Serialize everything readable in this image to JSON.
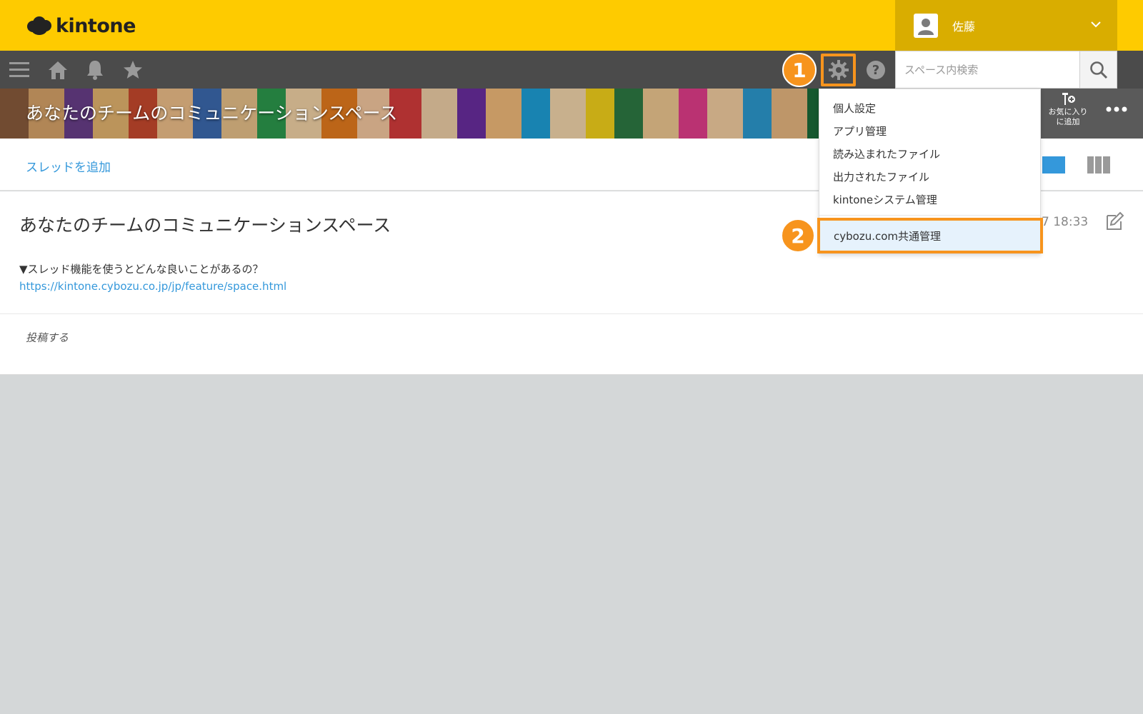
{
  "header": {
    "logo_text": "kintone",
    "user_name": "佐藤"
  },
  "toolbar": {
    "icons": [
      "menu-icon",
      "home-icon",
      "bell-icon",
      "star-icon",
      "gear-icon",
      "help-icon"
    ],
    "search_placeholder": "スペース内検索"
  },
  "steps": {
    "step1": "1",
    "step2": "2"
  },
  "banner": {
    "title": "あなたのチームのコミュニケーションスペース",
    "favorite_label_line1": "お気に入り",
    "favorite_label_line2": "に追加"
  },
  "thread_bar": {
    "add_thread": "スレッドを追加"
  },
  "thread": {
    "title": "あなたのチームのコミュニケーションスペース",
    "date": "7 18:33",
    "body": "▼スレッド機能を使うとどんな良いことがあるの？",
    "link": "https://kintone.cybozu.co.jp/jp/feature/space.html"
  },
  "post": {
    "label": "投稿する"
  },
  "dropdown": {
    "items": [
      "個人設定",
      "アプリ管理",
      "読み込まれたファイル",
      "出力されたファイル",
      "kintoneシステム管理"
    ],
    "highlighted": "cybozu.com共通管理"
  },
  "colors": {
    "header_yellow": "#fecb00",
    "toolbar_gray": "#4b4b4b",
    "accent_orange": "#f7941d",
    "link_blue": "#3498db"
  }
}
